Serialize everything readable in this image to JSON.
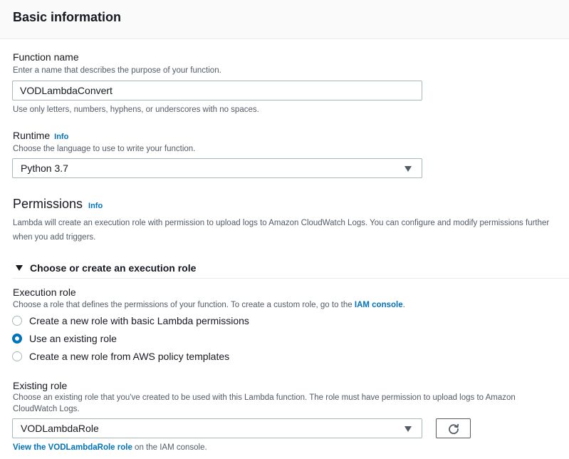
{
  "header": {
    "title": "Basic information"
  },
  "function_name": {
    "label": "Function name",
    "description": "Enter a name that describes the purpose of your function.",
    "value": "VODLambdaConvert",
    "hint": "Use only letters, numbers, hyphens, or underscores with no spaces."
  },
  "runtime": {
    "label": "Runtime",
    "info": "Info",
    "description": "Choose the language to use to write your function.",
    "selected": "Python 3.7"
  },
  "permissions": {
    "title": "Permissions",
    "info": "Info",
    "description": "Lambda will create an execution role with permission to upload logs to Amazon CloudWatch Logs. You can configure and modify permissions further when you add triggers."
  },
  "expander": {
    "label": "Choose or create an execution role"
  },
  "execution_role": {
    "label": "Execution role",
    "description_prefix": "Choose a role that defines the permissions of your function. To create a custom role, go to the ",
    "description_link": "IAM console",
    "description_suffix": ".",
    "options": [
      {
        "label": "Create a new role with basic Lambda permissions",
        "checked": false
      },
      {
        "label": "Use an existing role",
        "checked": true
      },
      {
        "label": "Create a new role from AWS policy templates",
        "checked": false
      }
    ]
  },
  "existing_role": {
    "label": "Existing role",
    "description_line1": "Choose an existing role that you've created to be used with this Lambda function. The role must have permission to upload logs to Amazon",
    "description_line2": "CloudWatch Logs.",
    "selected": "VODLambdaRole",
    "view_link": "View the VODLambdaRole role",
    "view_suffix": " on the IAM console."
  },
  "colors": {
    "link": "#0073bb",
    "text": "#16191f",
    "secondary_text": "#545b64",
    "border": "#aab7b8"
  },
  "icons": {
    "dropdown": "caret-down-icon",
    "expander": "caret-down-icon",
    "refresh": "refresh-icon"
  }
}
